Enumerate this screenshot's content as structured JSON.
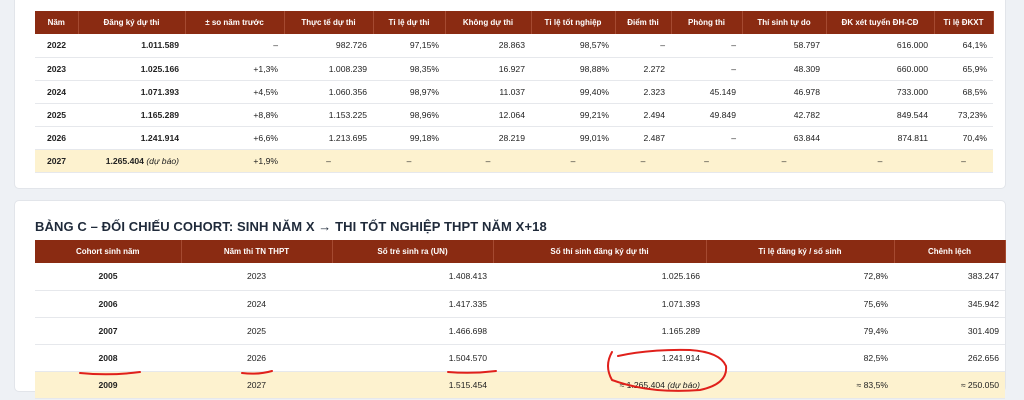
{
  "table_a": {
    "headers": [
      "Năm",
      "Đăng ký dự thi",
      "± so năm trước",
      "Thực tế dự thi",
      "Tỉ lệ dự thi",
      "Không dự thi",
      "Tỉ lệ tốt nghiệp",
      "Điểm thi",
      "Phòng thi",
      "Thí sinh tự do",
      "ĐK xét tuyển ĐH-CĐ",
      "Tỉ lệ ĐKXT"
    ],
    "rows": [
      [
        "2022",
        "1.011.589",
        "–",
        "982.726",
        "97,15%",
        "28.863",
        "98,57%",
        "–",
        "–",
        "58.797",
        "616.000",
        "64,1%"
      ],
      [
        "2023",
        "1.025.166",
        "+1,3%",
        "1.008.239",
        "98,35%",
        "16.927",
        "98,88%",
        "2.272",
        "–",
        "48.309",
        "660.000",
        "65,9%"
      ],
      [
        "2024",
        "1.071.393",
        "+4,5%",
        "1.060.356",
        "98,97%",
        "11.037",
        "99,40%",
        "2.323",
        "45.149",
        "46.978",
        "733.000",
        "68,5%"
      ],
      [
        "2025",
        "1.165.289",
        "+8,8%",
        "1.153.225",
        "98,96%",
        "12.064",
        "99,21%",
        "2.494",
        "49.849",
        "42.782",
        "849.544",
        "73,23%"
      ],
      [
        "2026",
        "1.241.914",
        "+6,6%",
        "1.213.695",
        "99,18%",
        "28.219",
        "99,01%",
        "2.487",
        "–",
        "63.844",
        "874.811",
        "70,4%"
      ]
    ],
    "forecast_row": {
      "year": "2027",
      "registered": "1.265.404",
      "note": "(dự báo)",
      "change": "+1,9%",
      "rest": [
        "–",
        "–",
        "–",
        "–",
        "–",
        "–",
        "–",
        "–",
        "–"
      ]
    }
  },
  "table_c": {
    "title": "BẢNG C – ĐỐI CHIẾU COHORT: SINH NĂM X → THI TỐT NGHIỆP THPT NĂM X+18",
    "headers": [
      "Cohort sinh năm",
      "Năm thi TN THPT",
      "Số trẻ sinh ra (UN)",
      "Số thí sinh đăng ký dự thi",
      "Tỉ lệ đăng ký / số sinh",
      "Chênh lệch"
    ],
    "rows": [
      [
        "2005",
        "2023",
        "1.408.413",
        "1.025.166",
        "72,8%",
        "383.247"
      ],
      [
        "2006",
        "2024",
        "1.417.335",
        "1.071.393",
        "75,6%",
        "345.942"
      ],
      [
        "2007",
        "2025",
        "1.466.698",
        "1.165.289",
        "79,4%",
        "301.409"
      ],
      [
        "2008",
        "2026",
        "1.504.570",
        "1.241.914",
        "82,5%",
        "262.656"
      ]
    ],
    "forecast_row": {
      "cohort": "2009",
      "exam_year": "2027",
      "births": "1.515.454",
      "registered": "≈ 1.265.404",
      "note": "(dự báo)",
      "ratio": "≈ 83,5%",
      "gap": "≈ 250.050"
    }
  },
  "colors": {
    "header_bg": "#8a2b12",
    "forecast_row_bg": "#fdf2cf",
    "annotation_red": "#e0201b"
  }
}
